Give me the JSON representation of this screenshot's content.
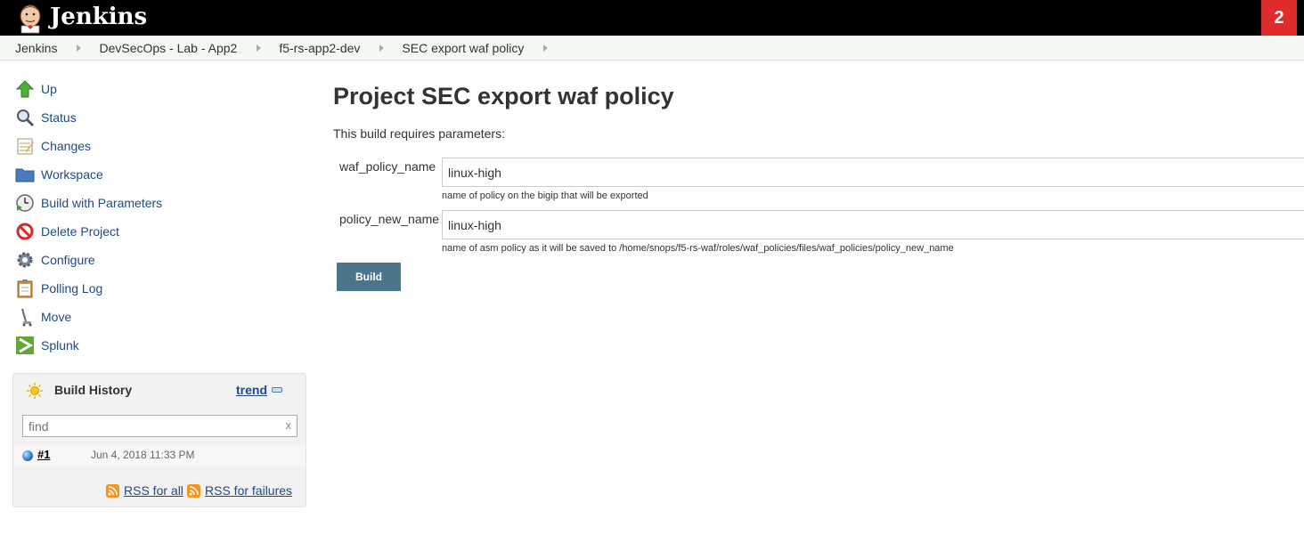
{
  "header": {
    "brand": "Jenkins",
    "alert_count": "2"
  },
  "breadcrumb": [
    {
      "label": "Jenkins"
    },
    {
      "label": "DevSecOps - Lab - App2"
    },
    {
      "label": "f5-rs-app2-dev"
    },
    {
      "label": "SEC export waf policy"
    }
  ],
  "tasks": [
    {
      "label": "Up",
      "icon": "up-arrow-icon"
    },
    {
      "label": "Status",
      "icon": "magnifier-icon"
    },
    {
      "label": "Changes",
      "icon": "notepad-icon"
    },
    {
      "label": "Workspace",
      "icon": "folder-icon"
    },
    {
      "label": "Build with Parameters",
      "icon": "clock-play-icon"
    },
    {
      "label": "Delete Project",
      "icon": "no-entry-icon"
    },
    {
      "label": "Configure",
      "icon": "gear-icon"
    },
    {
      "label": "Polling Log",
      "icon": "clipboard-icon"
    },
    {
      "label": "Move",
      "icon": "move-icon"
    },
    {
      "label": "Splunk",
      "icon": "splunk-icon"
    }
  ],
  "build_history": {
    "title": "Build History",
    "trend_label": "trend",
    "search_placeholder": "find",
    "search_clear": "x",
    "builds": [
      {
        "number": "#1",
        "date": "Jun 4, 2018 11:33 PM",
        "status": "success"
      }
    ],
    "rss_all": "RSS for all",
    "rss_failures": "RSS for failures"
  },
  "main": {
    "title": "Project SEC export waf policy",
    "requires_params": "This build requires parameters:",
    "params": [
      {
        "name": "waf_policy_name",
        "value": "linux-high",
        "description": "name of policy on the bigip that will be exported"
      },
      {
        "name": "policy_new_name",
        "value": "linux-high",
        "description": "name of asm policy as it will be saved to /home/snops/f5-rs-waf/roles/waf_policies/files/waf_policies/policy_new_name"
      }
    ],
    "build_button": "Build"
  },
  "colors": {
    "header_bg": "#000000",
    "alert_badge": "#e02b2b",
    "link": "#204a87",
    "build_button": "#4b758b",
    "breadcrumb_bg": "#f4f8f2"
  }
}
